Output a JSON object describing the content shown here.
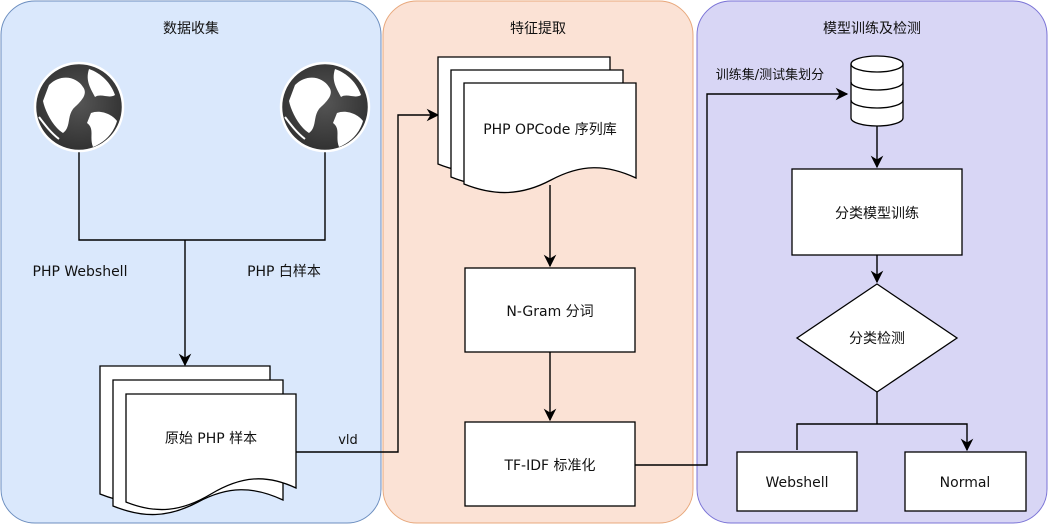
{
  "lanes": {
    "collect": {
      "title": "数据收集",
      "fill": "#dae8fc",
      "stroke": "#6c8ebf"
    },
    "extract": {
      "title": "特征提取",
      "fill": "#fbe2d5",
      "stroke": "#e8a87c"
    },
    "train": {
      "title": "模型训练及检测",
      "fill": "#d8d6f5",
      "stroke": "#7a73d6"
    }
  },
  "collect": {
    "webshell_source_label": "PHP Webshell",
    "normal_source_label": "PHP 白样本",
    "raw_samples_label": "原始 PHP 样本",
    "edge_label": "vld"
  },
  "extract": {
    "opcode_db_label": "PHP OPCode 序列库",
    "ngram_label": "N-Gram 分词",
    "tfidf_label": "TF-IDF 标准化"
  },
  "train": {
    "split_label": "训练集/测试集划分",
    "train_label": "分类模型训练",
    "detect_label": "分类检测",
    "out_webshell_label": "Webshell",
    "out_normal_label": "Normal"
  }
}
